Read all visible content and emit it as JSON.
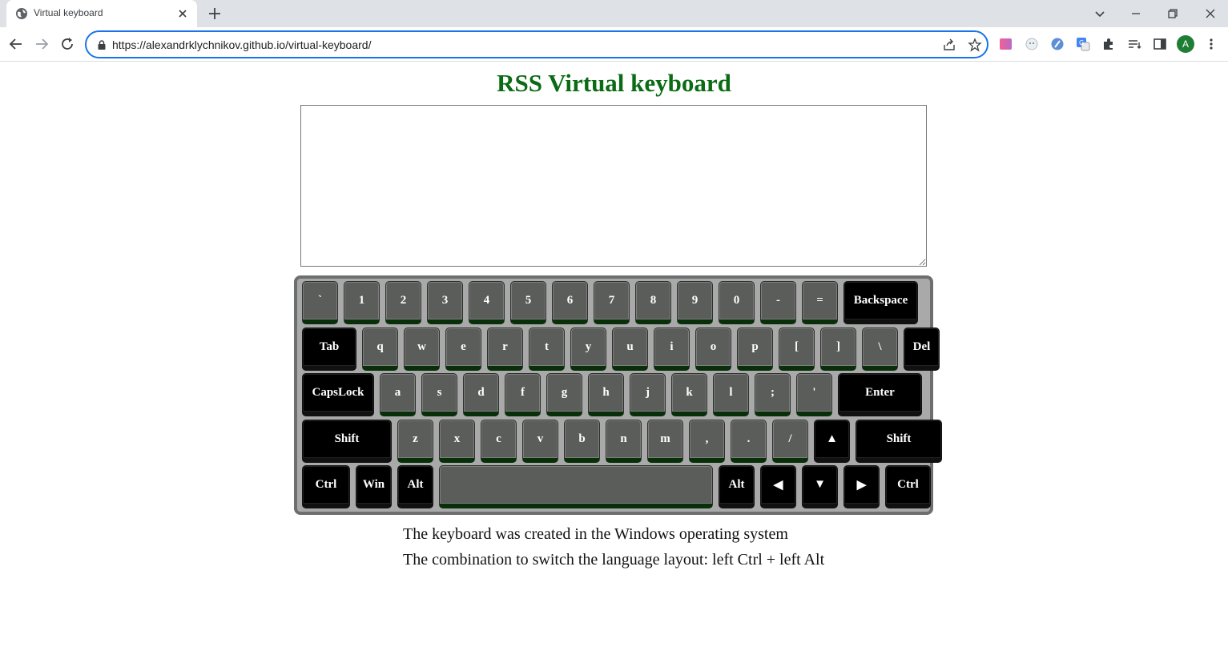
{
  "browser": {
    "tab_title": "Virtual keyboard",
    "url": "https://alexandrklychnikov.github.io/virtual-keyboard/",
    "avatar_letter": "A"
  },
  "page": {
    "title": "RSS Virtual keyboard",
    "info_line_1": "The keyboard was created in the Windows operating system",
    "info_line_2": "The combination to switch the language layout: left Ctrl + left Alt"
  },
  "keyboard": {
    "rows": [
      [
        {
          "label": "`",
          "w": 45,
          "dark": false
        },
        {
          "label": "1",
          "w": 45,
          "dark": false
        },
        {
          "label": "2",
          "w": 45,
          "dark": false
        },
        {
          "label": "3",
          "w": 45,
          "dark": false
        },
        {
          "label": "4",
          "w": 45,
          "dark": false
        },
        {
          "label": "5",
          "w": 45,
          "dark": false
        },
        {
          "label": "6",
          "w": 45,
          "dark": false
        },
        {
          "label": "7",
          "w": 45,
          "dark": false
        },
        {
          "label": "8",
          "w": 45,
          "dark": false
        },
        {
          "label": "9",
          "w": 45,
          "dark": false
        },
        {
          "label": "0",
          "w": 45,
          "dark": false
        },
        {
          "label": "-",
          "w": 45,
          "dark": false
        },
        {
          "label": "=",
          "w": 45,
          "dark": false
        },
        {
          "label": "Backspace",
          "w": 93,
          "dark": true
        }
      ],
      [
        {
          "label": "Tab",
          "w": 68,
          "dark": true
        },
        {
          "label": "q",
          "w": 45,
          "dark": false
        },
        {
          "label": "w",
          "w": 45,
          "dark": false
        },
        {
          "label": "e",
          "w": 45,
          "dark": false
        },
        {
          "label": "r",
          "w": 45,
          "dark": false
        },
        {
          "label": "t",
          "w": 45,
          "dark": false
        },
        {
          "label": "y",
          "w": 45,
          "dark": false
        },
        {
          "label": "u",
          "w": 45,
          "dark": false
        },
        {
          "label": "i",
          "w": 45,
          "dark": false
        },
        {
          "label": "o",
          "w": 45,
          "dark": false
        },
        {
          "label": "p",
          "w": 45,
          "dark": false
        },
        {
          "label": "[",
          "w": 45,
          "dark": false
        },
        {
          "label": "]",
          "w": 45,
          "dark": false
        },
        {
          "label": "\\",
          "w": 45,
          "dark": false
        },
        {
          "label": "Del",
          "w": 45,
          "dark": true
        }
      ],
      [
        {
          "label": "CapsLock",
          "w": 90,
          "dark": true
        },
        {
          "label": "a",
          "w": 45,
          "dark": false
        },
        {
          "label": "s",
          "w": 45,
          "dark": false
        },
        {
          "label": "d",
          "w": 45,
          "dark": false
        },
        {
          "label": "f",
          "w": 45,
          "dark": false
        },
        {
          "label": "g",
          "w": 45,
          "dark": false
        },
        {
          "label": "h",
          "w": 45,
          "dark": false
        },
        {
          "label": "j",
          "w": 45,
          "dark": false
        },
        {
          "label": "k",
          "w": 45,
          "dark": false
        },
        {
          "label": "l",
          "w": 45,
          "dark": false
        },
        {
          "label": ";",
          "w": 45,
          "dark": false
        },
        {
          "label": "'",
          "w": 45,
          "dark": false
        },
        {
          "label": "Enter",
          "w": 105,
          "dark": true
        }
      ],
      [
        {
          "label": "Shift",
          "w": 112,
          "dark": true
        },
        {
          "label": "z",
          "w": 45,
          "dark": false
        },
        {
          "label": "x",
          "w": 45,
          "dark": false
        },
        {
          "label": "c",
          "w": 45,
          "dark": false
        },
        {
          "label": "v",
          "w": 45,
          "dark": false
        },
        {
          "label": "b",
          "w": 45,
          "dark": false
        },
        {
          "label": "n",
          "w": 45,
          "dark": false
        },
        {
          "label": "m",
          "w": 45,
          "dark": false
        },
        {
          "label": ",",
          "w": 45,
          "dark": false
        },
        {
          "label": ".",
          "w": 45,
          "dark": false
        },
        {
          "label": "/",
          "w": 45,
          "dark": false
        },
        {
          "label": "▲",
          "w": 45,
          "dark": true
        },
        {
          "label": "Shift",
          "w": 108,
          "dark": true
        }
      ],
      [
        {
          "label": "Ctrl",
          "w": 60,
          "dark": true
        },
        {
          "label": "Win",
          "w": 45,
          "dark": true
        },
        {
          "label": "Alt",
          "w": 45,
          "dark": true
        },
        {
          "label": "",
          "w": 342,
          "dark": false
        },
        {
          "label": "Alt",
          "w": 45,
          "dark": true
        },
        {
          "label": "◀",
          "w": 45,
          "dark": true
        },
        {
          "label": "▼",
          "w": 45,
          "dark": true
        },
        {
          "label": "▶",
          "w": 45,
          "dark": true
        },
        {
          "label": "Ctrl",
          "w": 57,
          "dark": true
        }
      ]
    ]
  }
}
